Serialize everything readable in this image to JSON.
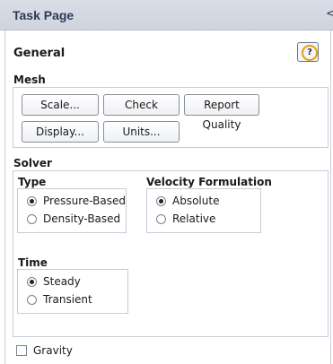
{
  "panel": {
    "title": "Task Page",
    "collapse_glyph": "<"
  },
  "general": {
    "heading": "General",
    "help_icon": "help-icon",
    "help_glyph": "?"
  },
  "mesh": {
    "heading": "Mesh",
    "buttons": {
      "scale": "Scale...",
      "check": "Check",
      "report_quality": "Report Quality",
      "display": "Display...",
      "units": "Units..."
    }
  },
  "solver": {
    "heading": "Solver",
    "type": {
      "heading": "Type",
      "options": [
        "Pressure-Based",
        "Density-Based"
      ],
      "selected": "Pressure-Based"
    },
    "velocity_formulation": {
      "heading": "Velocity Formulation",
      "options": [
        "Absolute",
        "Relative"
      ],
      "selected": "Absolute"
    },
    "time": {
      "heading": "Time",
      "options": [
        "Steady",
        "Transient"
      ],
      "selected": "Steady"
    }
  },
  "gravity": {
    "label": "Gravity",
    "checked": false
  },
  "colors": {
    "title_bg": "#d3d8e1",
    "accent_help": "#e0a010"
  }
}
